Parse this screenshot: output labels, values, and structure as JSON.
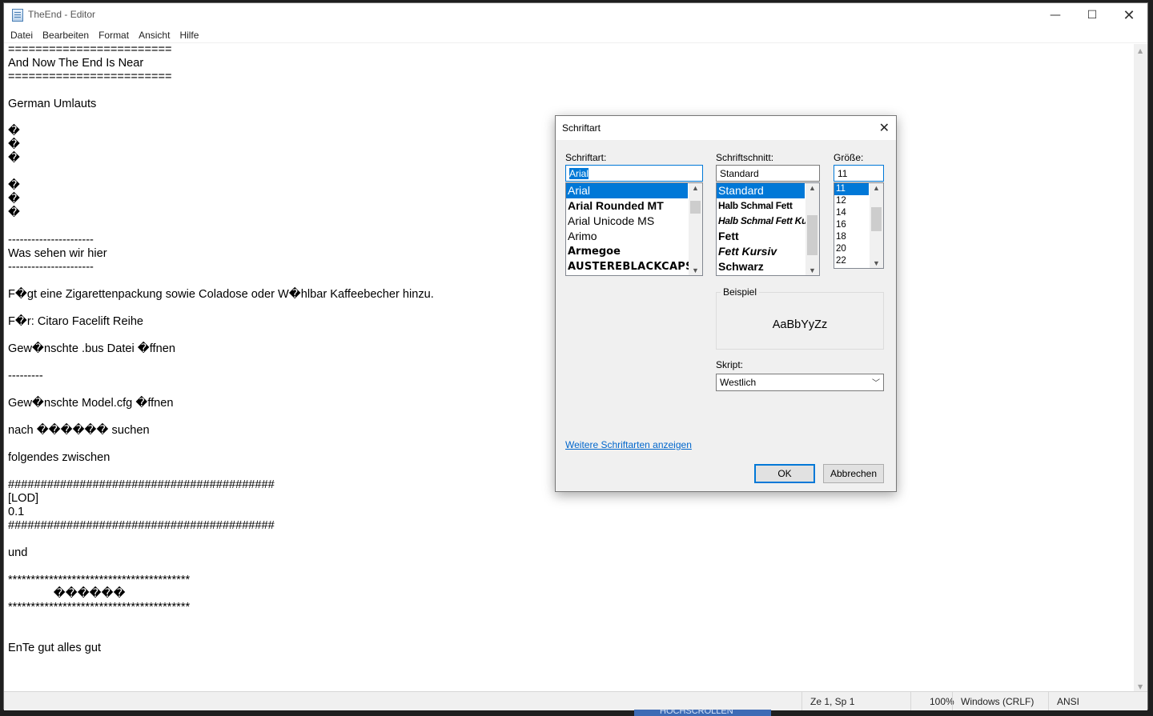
{
  "window": {
    "title": "TheEnd - Editor",
    "minimize_glyph": "—",
    "maximize_glyph": "☐",
    "close_glyph": "✕"
  },
  "menu": [
    "Datei",
    "Bearbeiten",
    "Format",
    "Ansicht",
    "Hilfe"
  ],
  "editor": {
    "lines": [
      "========================",
      "And Now The End Is Near",
      "========================",
      "",
      "German Umlauts",
      "",
      "�",
      "�",
      "�",
      "",
      "�",
      "�",
      "�",
      "",
      "----------------------",
      "Was sehen wir hier",
      "----------------------",
      "",
      "F�gt eine Zigarettenpackung sowie Coladose oder W�hlbar Kaffeebecher hinzu.",
      "",
      "F�r: Citaro Facelift Reihe",
      "",
      "Gew�nschte .bus Datei �ffnen",
      "",
      "---------",
      "",
      "Gew�nschte Model.cfg �ffnen",
      "",
      "nach ������ suchen",
      "",
      "folgendes zwischen",
      "",
      "#########################################",
      "[LOD]",
      "0.1",
      "#########################################",
      "",
      "und",
      "",
      "****************************************",
      "              ������",
      "****************************************",
      "",
      "",
      "EnTe gut alles gut"
    ]
  },
  "statusbar": {
    "position": "Ze 1, Sp 1",
    "zoom": "100%",
    "line_ending": "Windows (CRLF)",
    "encoding": "ANSI"
  },
  "taskbar_stub": "HOCHSCROLLEN",
  "font_dialog": {
    "title": "Schriftart",
    "close_glyph": "✕",
    "family_label": "Schriftart:",
    "family_value": "Arial",
    "families": [
      "Arial",
      "Arial Rounded MT",
      "Arial Unicode MS",
      "Arimo",
      "Armegoe",
      "AUSTEREBLACKCAPS"
    ],
    "style_label": "Schriftschnitt:",
    "style_value": "Standard",
    "styles": [
      "Standard",
      "Halb Schmal Fett",
      "Halb Schmal Fett Kursiv",
      "Fett",
      "Fett Kursiv",
      "Schwarz"
    ],
    "size_label": "Größe:",
    "size_value": "11",
    "sizes": [
      "11",
      "12",
      "14",
      "16",
      "18",
      "20",
      "22"
    ],
    "sample_label": "Beispiel",
    "sample_text": "AaBbYyZz",
    "script_label": "Skript:",
    "script_value": "Westlich",
    "more_fonts_link": "Weitere Schriftarten anzeigen",
    "ok_label": "OK",
    "cancel_label": "Abbrechen"
  },
  "colors": {
    "selection": "#0078d7",
    "link": "#0066cc"
  }
}
